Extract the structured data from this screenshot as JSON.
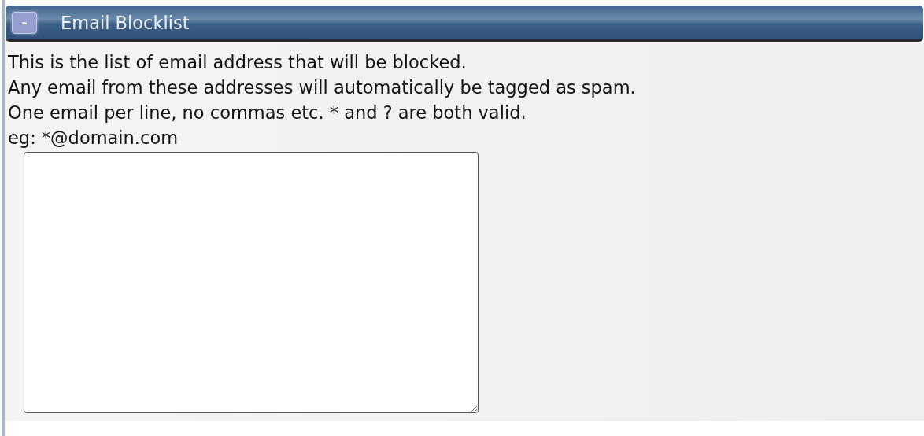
{
  "panel": {
    "toggle_label": "-",
    "title": "Email Blocklist"
  },
  "description": [
    "This is the list of email address that will be blocked.",
    "Any email from these addresses will automatically be tagged as spam.",
    "One email per line, no commas etc. * and ? are both valid.",
    "eg: *@domain.com"
  ]
}
